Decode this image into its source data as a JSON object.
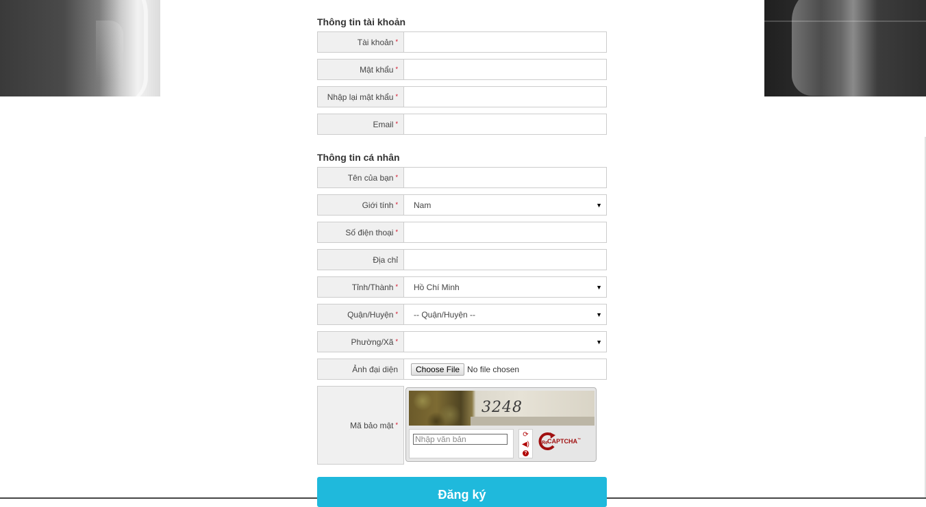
{
  "sections": {
    "account": {
      "title": "Thông tin tài khoản",
      "fields": [
        {
          "label": "Tài khoản",
          "required": "*",
          "value": ""
        },
        {
          "label": "Mật khẩu",
          "required": "*",
          "value": ""
        },
        {
          "label": "Nhập lại mật khẩu",
          "required": "*",
          "value": ""
        },
        {
          "label": "Email",
          "required": "*",
          "value": ""
        }
      ]
    },
    "personal": {
      "title": "Thông tin cá nhân",
      "name": {
        "label": "Tên của bạn",
        "required": "*",
        "value": ""
      },
      "gender": {
        "label": "Giới tính",
        "required": "*",
        "selected": "Nam"
      },
      "phone": {
        "label": "Số điện thoại",
        "required": "*",
        "value": ""
      },
      "address": {
        "label": "Địa chỉ",
        "value": ""
      },
      "province": {
        "label": "Tỉnh/Thành",
        "required": "*",
        "selected": "Hồ Chí Minh"
      },
      "district": {
        "label": "Quận/Huyện",
        "required": "*",
        "selected": "-- Quận/Huyện --"
      },
      "ward": {
        "label": "Phường/Xã",
        "required": "*",
        "selected": ""
      },
      "avatar": {
        "label": "Ảnh đại diện",
        "button": "Choose File",
        "status": "No file chosen"
      },
      "captcha": {
        "label": "Mã bảo mật",
        "required": "*",
        "code": "3248",
        "placeholder": "Nhập văn bản",
        "logo_prefix": "Re",
        "logo_text": "CAPTCHA",
        "logo_tm": "™",
        "icons": [
          "refresh-icon",
          "audio-icon",
          "help-icon"
        ]
      }
    }
  },
  "submit": {
    "label": "Đăng ký"
  },
  "colors": {
    "submit_bg": "#1fb9dc",
    "required_mark": "#d0021b",
    "label_bg": "#f0f0f0",
    "recaptcha_red": "#a01010"
  }
}
